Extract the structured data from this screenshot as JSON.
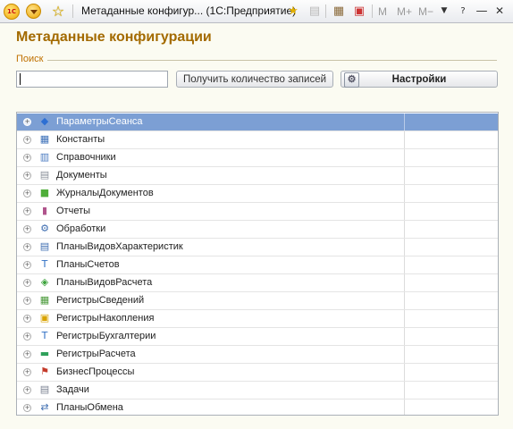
{
  "window": {
    "logo": "1С",
    "title": "Метаданные конфигур...  (1С:Предприятие)",
    "buttons": {
      "m": "M",
      "mplus": "M+",
      "mminus": "M−"
    }
  },
  "page": {
    "title": "Метаданные конфигурации",
    "search_label": "Поиск",
    "search_value": "",
    "count_button": "Получить количество записей",
    "settings_button": "Настройки"
  },
  "tree": {
    "selected_index": 0,
    "items": [
      {
        "label": "ПараметрыСеанса",
        "icon": "session-params-icon",
        "glyph": "◆",
        "color": "#2d6fd3"
      },
      {
        "label": "Константы",
        "icon": "constants-icon",
        "glyph": "▦",
        "color": "#3b6fb8"
      },
      {
        "label": "Справочники",
        "icon": "catalogs-icon",
        "glyph": "▥",
        "color": "#4a7ac0"
      },
      {
        "label": "Документы",
        "icon": "documents-icon",
        "glyph": "▤",
        "color": "#8a8f99"
      },
      {
        "label": "ЖурналыДокументов",
        "icon": "document-journals-icon",
        "glyph": "■",
        "color": "#4fae3a"
      },
      {
        "label": "Отчеты",
        "icon": "reports-icon",
        "glyph": "▮",
        "color": "#b0548c"
      },
      {
        "label": "Обработки",
        "icon": "data-processors-icon",
        "glyph": "⚙",
        "color": "#3d6cb0"
      },
      {
        "label": "ПланыВидовХарактеристик",
        "icon": "characteristic-types-icon",
        "glyph": "▤",
        "color": "#3d6cb0"
      },
      {
        "label": "ПланыСчетов",
        "icon": "charts-of-accounts-icon",
        "glyph": "Т",
        "color": "#2f6fc4"
      },
      {
        "label": "ПланыВидовРасчета",
        "icon": "calculation-types-icon",
        "glyph": "◈",
        "color": "#3aa23a"
      },
      {
        "label": "РегистрыСведений",
        "icon": "information-registers-icon",
        "glyph": "▦",
        "color": "#4a9a3a"
      },
      {
        "label": "РегистрыНакопления",
        "icon": "accumulation-registers-icon",
        "glyph": "▣",
        "color": "#d9a300"
      },
      {
        "label": "РегистрыБухгалтерии",
        "icon": "accounting-registers-icon",
        "glyph": "Т",
        "color": "#2f6fc4"
      },
      {
        "label": "РегистрыРасчета",
        "icon": "calculation-registers-icon",
        "glyph": "▬",
        "color": "#2fa05a"
      },
      {
        "label": "БизнесПроцессы",
        "icon": "business-processes-icon",
        "glyph": "⚑",
        "color": "#c43a2a"
      },
      {
        "label": "Задачи",
        "icon": "tasks-icon",
        "glyph": "▤",
        "color": "#7a8090"
      },
      {
        "label": "ПланыОбмена",
        "icon": "exchange-plans-icon",
        "glyph": "⇄",
        "color": "#3d6cb0"
      }
    ]
  }
}
